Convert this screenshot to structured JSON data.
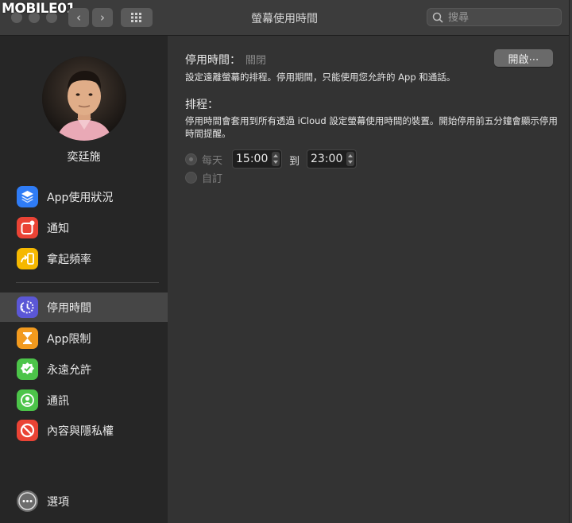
{
  "watermark": "MOBILE01",
  "window": {
    "title": "螢幕使用時間",
    "search_placeholder": "搜尋",
    "nav_back": "‹",
    "nav_forward": "›"
  },
  "user": {
    "name": "奕廷施"
  },
  "sidebar": {
    "items": [
      {
        "label": "App使用狀況",
        "color": "#2f7cf6",
        "icon": "layers-icon"
      },
      {
        "label": "通知",
        "color": "#ea4335",
        "icon": "notification-icon"
      },
      {
        "label": "拿起頻率",
        "color": "#f5b800",
        "icon": "pickup-icon"
      },
      {
        "label": "停用時間",
        "color": "#5b57d6",
        "icon": "downtime-icon",
        "selected": true
      },
      {
        "label": "App限制",
        "color": "#f29a1e",
        "icon": "hourglass-icon"
      },
      {
        "label": "永遠允許",
        "color": "#4cc449",
        "icon": "checkmark-badge-icon"
      },
      {
        "label": "通訊",
        "color": "#4cc449",
        "icon": "contact-icon"
      },
      {
        "label": "內容與隱私權",
        "color": "#ea4335",
        "icon": "restriction-icon"
      }
    ],
    "options_label": "選項"
  },
  "main": {
    "downtime_label": "停用時間：",
    "downtime_status": "關閉",
    "downtime_desc": "設定遠離螢幕的排程。停用期間，只能使用您允許的 App 和通話。",
    "open_button": "開啟⋯",
    "schedule_label": "排程：",
    "schedule_desc": "停用時間會套用到所有透過 iCloud 設定螢幕使用時間的裝置。開始停用前五分鐘會顯示停用時間提醒。",
    "every_day_label": "每天",
    "custom_label": "自訂",
    "start_time": "15:00",
    "to_label": "到",
    "end_time": "23:00"
  }
}
